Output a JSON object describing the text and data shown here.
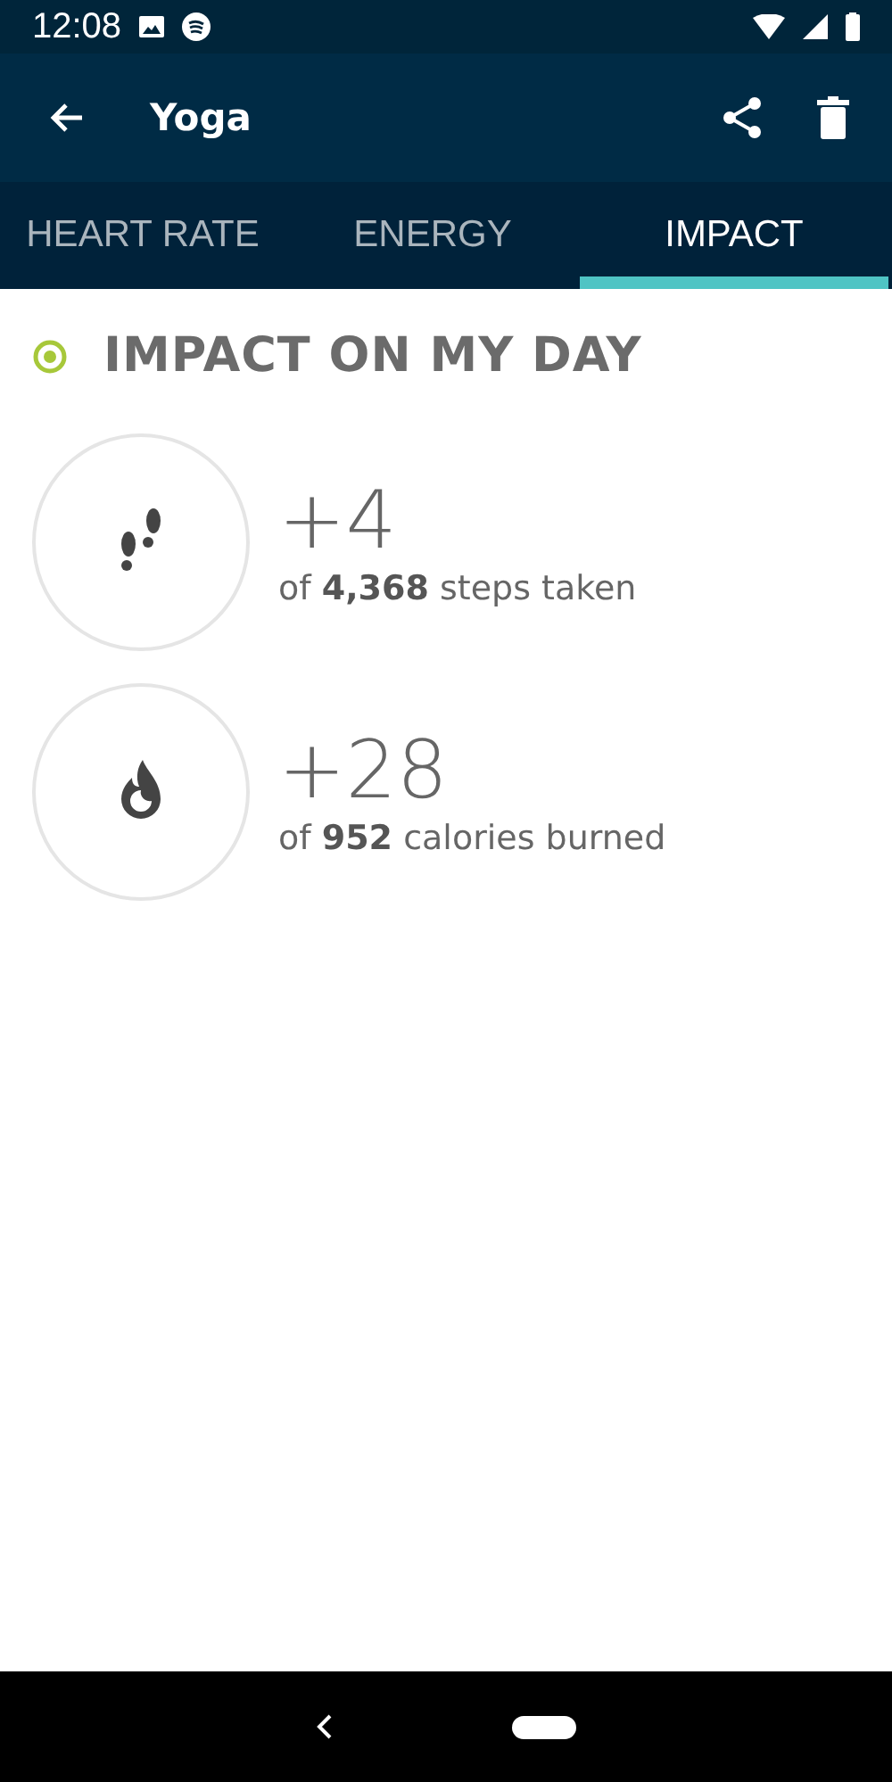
{
  "status_bar": {
    "time": "12:08"
  },
  "app_bar": {
    "title": "Yoga"
  },
  "tabs": [
    {
      "label": "HEART RATE",
      "selected": false
    },
    {
      "label": "ENERGY",
      "selected": false
    },
    {
      "label": "IMPACT",
      "selected": true
    }
  ],
  "section": {
    "title": "IMPACT ON MY DAY"
  },
  "stats": [
    {
      "kind": "steps",
      "value": "+4",
      "caption": "of **4,368** steps taken"
    },
    {
      "kind": "calories",
      "value": "+28",
      "caption": "of **952** calories burned"
    }
  ]
}
